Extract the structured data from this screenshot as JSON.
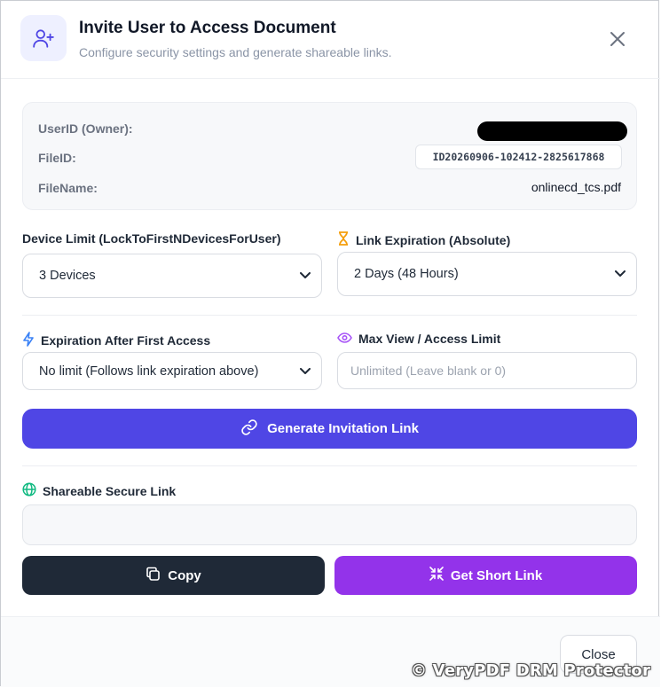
{
  "header": {
    "title": "Invite User to Access Document",
    "subtitle": "Configure security settings and generate shareable links.",
    "icon": "user-plus-icon",
    "close_icon": "close-icon"
  },
  "info": {
    "owner_label": "UserID (Owner):",
    "owner_value_redacted": true,
    "fileid_label": "FileID:",
    "fileid_value": "ID20260906-102412-2825617868",
    "filename_label": "FileName:",
    "filename_value": "onlinecd_tcs.pdf"
  },
  "device_limit": {
    "label": "Device Limit (LockToFirstNDevicesForUser)",
    "selected": "3 Devices"
  },
  "link_expiration": {
    "label": "Link Expiration (Absolute)",
    "icon": "hourglass-icon",
    "selected": "2 Days (48 Hours)"
  },
  "first_access": {
    "label": "Expiration After First Access",
    "icon": "lightning-icon",
    "selected": "No limit (Follows link expiration above)"
  },
  "max_view": {
    "label": "Max View / Access Limit",
    "icon": "eye-icon",
    "placeholder": "Unlimited (Leave blank or 0)"
  },
  "generate_button": {
    "label": "Generate Invitation Link",
    "icon": "link-icon"
  },
  "share": {
    "label": "Shareable Secure Link",
    "icon": "globe-icon",
    "value": ""
  },
  "copy_button": {
    "label": "Copy",
    "icon": "copy-icon"
  },
  "short_link_button": {
    "label": "Get Short Link",
    "icon": "compress-icon"
  },
  "footer": {
    "close_label": "Close"
  },
  "watermark": "© VeryPDF DRM Protector",
  "colors": {
    "primary": "#4f46e5",
    "purple": "#9333ea",
    "dark": "#1f2937",
    "hourglass": "#f59e0b",
    "globe": "#10b981",
    "eye": "#a855f7"
  }
}
